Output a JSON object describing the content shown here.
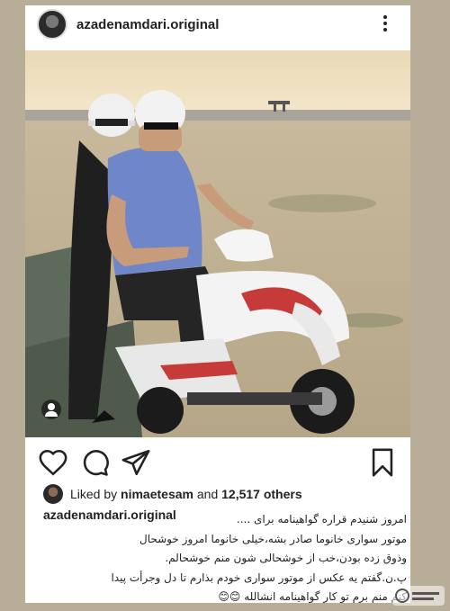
{
  "post": {
    "username": "azadenamdari.original",
    "liked_by_prefix": "Liked by",
    "liked_by_user": "nimaetesam",
    "liked_by_and": "and",
    "liked_by_count": "12,517 others",
    "caption_username": "azadenamdari.original",
    "caption_lines": [
      "امروز شنیدم قراره گواهینامه برای ....",
      "موتور سواری خانوما صادر بشه،خیلی خانوما امروز خوشحال",
      "وذوق زده بودن،خب از خوشحالی شون منم خوشحالم.",
      "پ.ن.گفتم یه عکس از موتور سواری خودم بذارم تا دل وجرأت پیدا",
      "کنم منم برم تو کار گواهینامه انشالله 😊😊"
    ]
  },
  "icons": {
    "more": "more-options-icon",
    "like": "heart-icon",
    "comment": "comment-icon",
    "share": "send-icon",
    "save": "bookmark-icon",
    "tag": "user-tag-icon"
  },
  "colors": {
    "background": "#b8ad97",
    "card": "#ffffff",
    "text": "#222222"
  }
}
